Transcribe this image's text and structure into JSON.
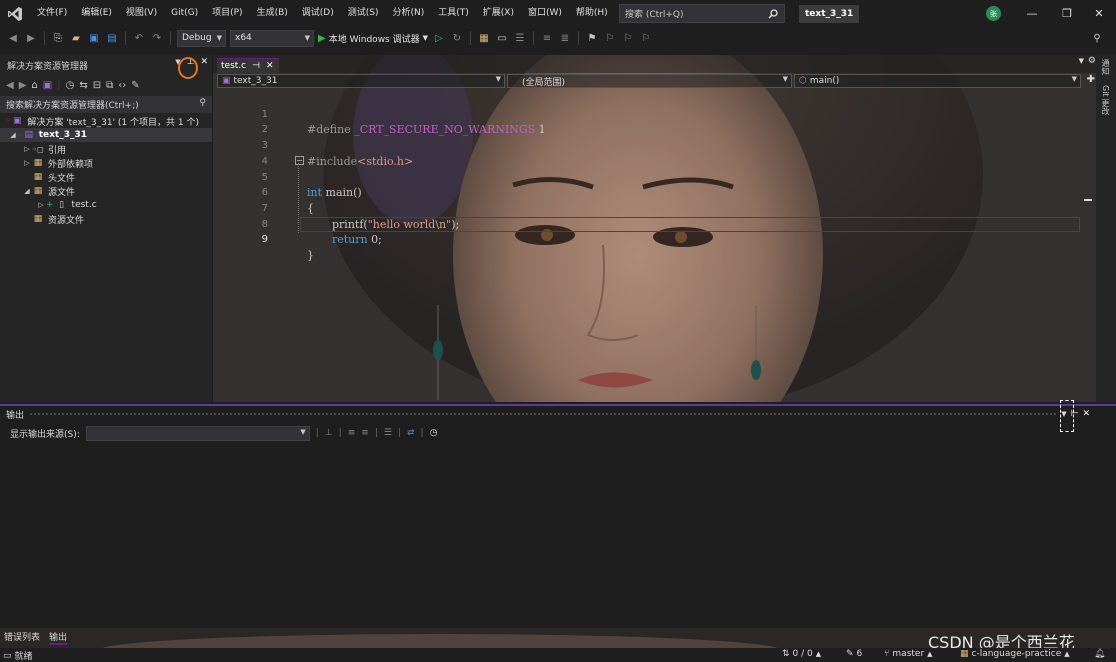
{
  "menu": {
    "items": [
      "文件(F)",
      "编辑(E)",
      "视图(V)",
      "Git(G)",
      "项目(P)",
      "生成(B)",
      "调试(D)",
      "测试(S)",
      "分析(N)",
      "工具(T)",
      "扩展(X)",
      "窗口(W)",
      "帮助(H)"
    ],
    "search_placeholder": "搜索 (Ctrl+Q)",
    "solution_name": "text_3_31",
    "avatar_initial": "张"
  },
  "toolbar": {
    "config": "Debug",
    "platform": "x64",
    "run_label": "本地 Windows 调试器"
  },
  "solution_explorer": {
    "title": "解决方案资源管理器",
    "search_placeholder": "搜索解决方案资源管理器(Ctrl+;)",
    "tree": {
      "solution": "解决方案 'text_3_31' (1 个项目，共 1 个)",
      "project": "text_3_31",
      "references": "引用",
      "external_deps": "外部依赖项",
      "header_files": "头文件",
      "source_files": "源文件",
      "test_c": "test.c",
      "resource_files": "资源文件"
    }
  },
  "editor": {
    "tab_label": "test.c",
    "nav_project": "text_3_31",
    "nav_scope": "(全局范围)",
    "nav_member": "main()",
    "line_numbers": [
      "1",
      "2",
      "3",
      "4",
      "5",
      "6",
      "7",
      "8",
      "9"
    ],
    "code": {
      "l1_directive": "#define",
      "l1_macro": "_CRT_SECURE_NO_WARNINGS",
      "l1_value": "1",
      "l3_directive": "#include",
      "l3_header": "<stdio.h>",
      "l5_type": "int",
      "l5_rest": "main()",
      "l6": "{",
      "l7_fn": "printf(",
      "l7_str": "\"hello world\\n\"",
      "l7_end": ");",
      "l8_kw": "return",
      "l8_rest": "0;",
      "l9": "}"
    }
  },
  "right_rail": {
    "tab1": "通知",
    "tab2": "Git 更改"
  },
  "output": {
    "title": "输出",
    "source_label": "显示输出来源(S):",
    "source_value": ""
  },
  "bottom_tabs": [
    "错误列表",
    "输出"
  ],
  "watermark": "CSDN @是个西兰花",
  "statusbar": {
    "ready": "就绪",
    "changes": "0 / 0",
    "pending": "6",
    "branch": "master",
    "repo": "c-language-practice"
  },
  "colors": {
    "accent_purple": "#68217a",
    "run_green": "#2fb94a",
    "highlight_orange": "#e87722",
    "keyword_blue": "#569cd6",
    "string_brown": "#d69d85",
    "macro_purple": "#bd63c5"
  }
}
